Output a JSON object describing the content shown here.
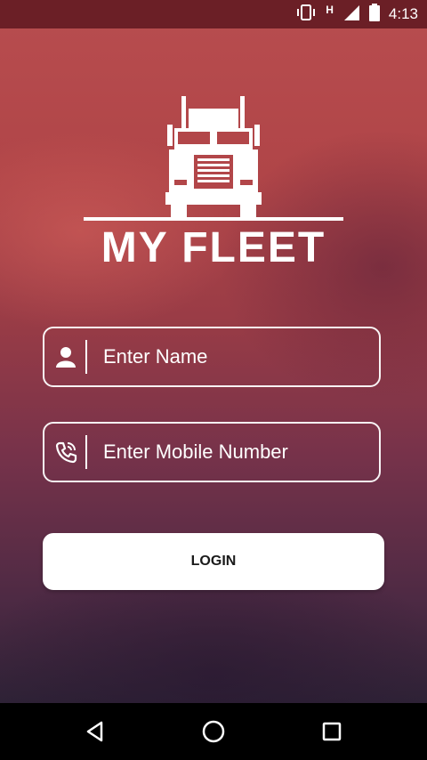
{
  "status_bar": {
    "time": "4:13",
    "network_label": "H",
    "icons": [
      "vibrate-icon",
      "network-type-icon",
      "signal-icon",
      "battery-icon"
    ]
  },
  "logo": {
    "text": "MY FLEET",
    "icon": "truck-icon"
  },
  "form": {
    "name_placeholder": "Enter Name",
    "name_value": "",
    "name_icon": "person-icon",
    "mobile_placeholder": "Enter Mobile Number",
    "mobile_value": "",
    "mobile_icon": "phone-icon"
  },
  "login_button": {
    "label": "LOGIN"
  },
  "nav_bar": {
    "back": "back-icon",
    "home": "home-icon",
    "recents": "recents-icon"
  },
  "colors": {
    "status_bar": "#6b1f26",
    "background_top": "#b84d4f",
    "background_bottom": "#2e2236",
    "field_border": "#ffffff",
    "button_bg": "#ffffff",
    "button_text": "#1a1a1a"
  }
}
